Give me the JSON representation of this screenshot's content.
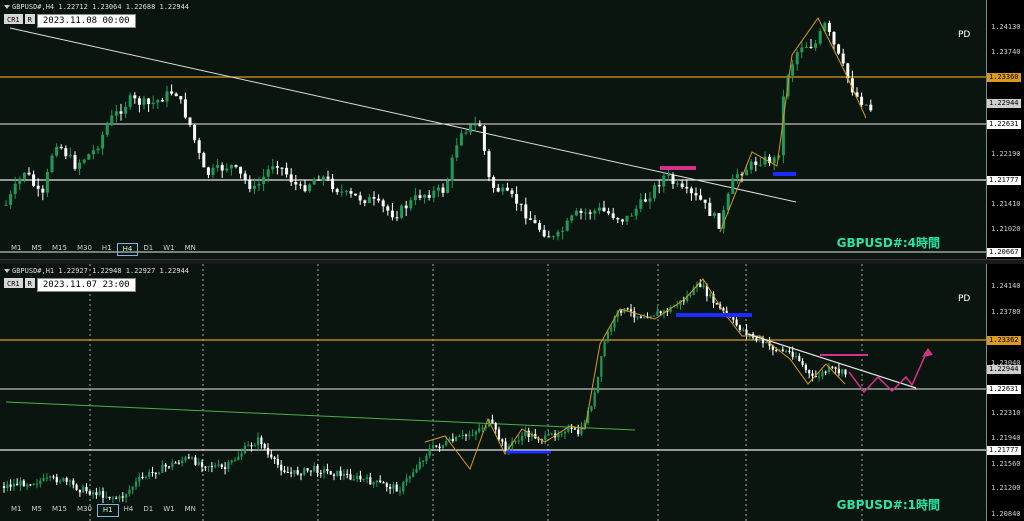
{
  "top": {
    "header": "GBPUSD#,H4  1.22712 1.23064 1.22688 1.22944",
    "cr_label": "CR1",
    "r_label": "R",
    "date_label": "2023.11.08 00:00",
    "pd_label": "PD",
    "chart_title": "GBPUSD#:4時間",
    "timeframes": [
      "M1",
      "M5",
      "M15",
      "M30",
      "H1",
      "H4",
      "D1",
      "W1",
      "MN"
    ],
    "active_tf": "H4",
    "ticks": [
      "1.24130",
      "1.23740",
      "1.23360",
      "1.22944",
      "1.22631",
      "1.22190",
      "1.21777",
      "1.21410",
      "1.21020",
      "1.20667"
    ],
    "tags": [
      {
        "text": "1.23360",
        "style": "orange"
      },
      {
        "text": "1.22944",
        "style": "grey"
      },
      {
        "text": "1.22631",
        "style": "white"
      },
      {
        "text": "1.21777",
        "style": "white"
      },
      {
        "text": "1.20667",
        "style": "white"
      }
    ]
  },
  "bottom": {
    "header": "GBPUSD#,H1  1.22927 1.22948 1.22927 1.22944",
    "cr_label": "CR1",
    "r_label": "R",
    "date_label": "2023.11.07 23:00",
    "pd_label": "PD",
    "chart_title": "GBPUSD#:1時間",
    "timeframes": [
      "M1",
      "M5",
      "M15",
      "M30",
      "H1",
      "H4",
      "D1",
      "W1",
      "MN"
    ],
    "active_tf": "H1",
    "ticks": [
      "1.24140",
      "1.23780",
      "1.23362",
      "1.23040",
      "1.22944",
      "1.22631",
      "1.22310",
      "1.21940",
      "1.21777",
      "1.21560",
      "1.21200",
      "1.20840"
    ],
    "tags": [
      {
        "text": "1.23362",
        "style": "orange"
      },
      {
        "text": "1.22944",
        "style": "grey"
      },
      {
        "text": "1.22631",
        "style": "white"
      },
      {
        "text": "1.21777",
        "style": "white"
      }
    ]
  },
  "colors": {
    "background": "#000000",
    "plot": "#0b1510",
    "bull": "#1f9a5a",
    "bear": "#ffffff",
    "orange": "#d99a1e",
    "magenta": "#d8308a",
    "blue": "#1a2cff",
    "title": "#26e6a6"
  }
}
